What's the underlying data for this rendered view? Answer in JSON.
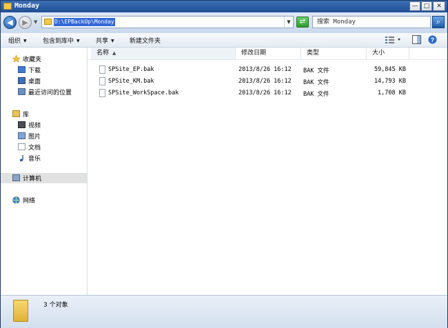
{
  "window": {
    "title": "Monday",
    "buttons": {
      "minimize": "—",
      "maximize": "□",
      "close": "✕"
    }
  },
  "address": {
    "path": "D:\\EPBackUp\\Monday",
    "search_placeholder": "搜索 Monday"
  },
  "toolbar": {
    "organize": "组织",
    "include_in_library": "包含到库中",
    "share": "共享",
    "new_folder": "新建文件夹"
  },
  "sidebar": {
    "favorites": "收藏夹",
    "downloads": "下载",
    "desktop": "桌面",
    "recent": "最近访问的位置",
    "libraries": "库",
    "videos": "视频",
    "pictures": "图片",
    "documents": "文档",
    "music": "音乐",
    "computer": "计算机",
    "network": "网络"
  },
  "columns": {
    "name": "名称",
    "modified": "修改日期",
    "type": "类型",
    "size": "大小"
  },
  "files": [
    {
      "name": "SPSite_EP.bak",
      "modified": "2013/8/26 16:12",
      "type": "BAK 文件",
      "size": "59,845 KB"
    },
    {
      "name": "SPSite_KM.bak",
      "modified": "2013/8/26 16:12",
      "type": "BAK 文件",
      "size": "14,793 KB"
    },
    {
      "name": "SPSite_WorkSpace.bak",
      "modified": "2013/8/26 16:12",
      "type": "BAK 文件",
      "size": "1,708 KB"
    }
  ],
  "status": {
    "count_text": "3 个对象"
  },
  "colors": {
    "accent": "#3368d6",
    "titlebar": "#1f4f94"
  },
  "icons": [
    "folder-icon",
    "back-icon",
    "forward-icon",
    "refresh-icon",
    "search-icon",
    "star-icon",
    "computer-icon",
    "network-icon",
    "library-icon",
    "file-icon"
  ]
}
